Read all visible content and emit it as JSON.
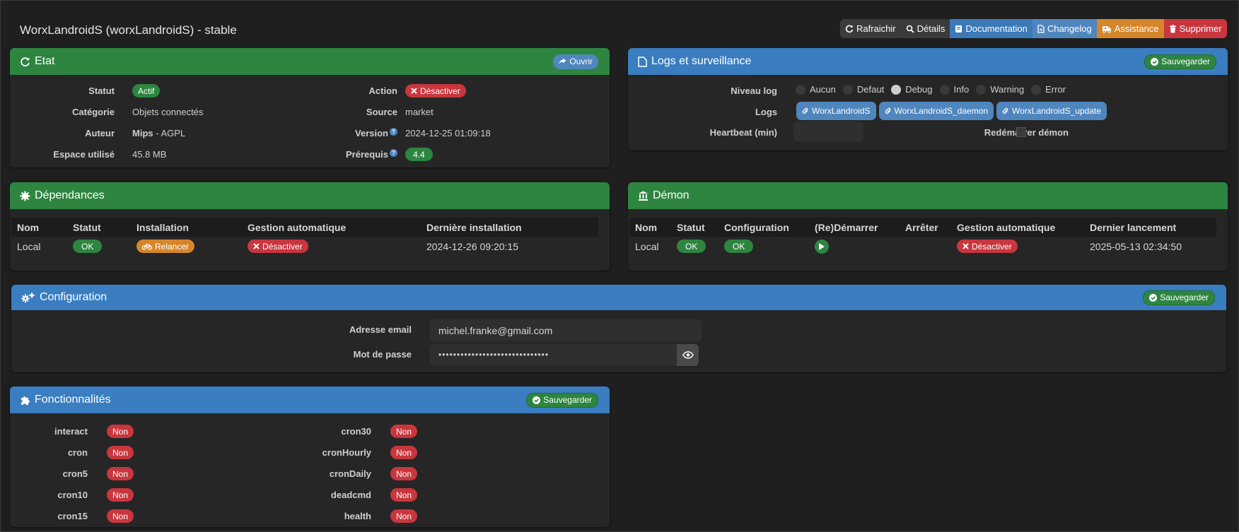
{
  "title": "WorxLandroidS (worxLandroidS) - stable",
  "toolbar": {
    "refresh": "Rafraichir",
    "details": "Détails",
    "documentation": "Documentation",
    "changelog": "Changelog",
    "assistance": "Assistance",
    "delete": "Supprimer"
  },
  "etat": {
    "title": "Etat",
    "open_label": "Ouvrir",
    "statut_label": "Statut",
    "statut_value": "Actif",
    "categorie_label": "Catégorie",
    "categorie_value": "Objets connectés",
    "auteur_label": "Auteur",
    "auteur_value": "Mips",
    "licence_value": "- AGPL",
    "espace_label": "Espace utilisé",
    "espace_value": "45.8 MB",
    "action_label": "Action",
    "action_value": "Désactiver",
    "source_label": "Source",
    "source_value": "market",
    "version_label": "Version",
    "version_value": "2024-12-25 01:09:18",
    "prerequis_label": "Prérequis",
    "prerequis_value": "4.4",
    "help_glyph": "?"
  },
  "logs": {
    "title": "Logs et surveillance",
    "save_label": "Sauvegarder",
    "niveau_label": "Niveau log",
    "levels": [
      "Aucun",
      "Defaut",
      "Debug",
      "Info",
      "Warning",
      "Error"
    ],
    "selected_level": "Debug",
    "logs_label": "Logs",
    "log_files": [
      "WorxLandroidS",
      "WorxLandroidS_daemon",
      "WorxLandroidS_update"
    ],
    "heartbeat_label": "Heartbeat (min)",
    "heartbeat_value": "",
    "restart_label": "Redémarrer démon",
    "restart_checked": false
  },
  "dependances": {
    "title": "Dépendances",
    "headers": [
      "Nom",
      "Statut",
      "Installation",
      "Gestion automatique",
      "Dernière installation"
    ],
    "row": {
      "nom": "Local",
      "statut": "OK",
      "installation": "Relancer",
      "gestion": "Désactiver",
      "derniere": "2024-12-26 09:20:15"
    }
  },
  "demon": {
    "title": "Démon",
    "headers": [
      "Nom",
      "Statut",
      "Configuration",
      "(Re)Démarrer",
      "Arrêter",
      "Gestion automatique",
      "Dernier lancement"
    ],
    "row": {
      "nom": "Local",
      "statut": "OK",
      "configuration": "OK",
      "gestion": "Désactiver",
      "dernier": "2025-05-13 02:34:50"
    }
  },
  "configuration": {
    "title": "Configuration",
    "save_label": "Sauvegarder",
    "email_label": "Adresse email",
    "email_value": "michel.franke@gmail.com",
    "password_label": "Mot de passe",
    "password_value": "••••••••••••••••••••••••••••••"
  },
  "fonctionnalites": {
    "title": "Fonctionnalités",
    "save_label": "Sauvegarder",
    "left": [
      {
        "name": "interact",
        "value": "Non"
      },
      {
        "name": "cron",
        "value": "Non"
      },
      {
        "name": "cron5",
        "value": "Non"
      },
      {
        "name": "cron10",
        "value": "Non"
      },
      {
        "name": "cron15",
        "value": "Non"
      }
    ],
    "right": [
      {
        "name": "cron30",
        "value": "Non"
      },
      {
        "name": "cronHourly",
        "value": "Non"
      },
      {
        "name": "cronDaily",
        "value": "Non"
      },
      {
        "name": "deadcmd",
        "value": "Non"
      },
      {
        "name": "health",
        "value": "Non"
      }
    ]
  },
  "colors": {
    "green": "#2e8540",
    "blue": "#3a7dc0",
    "red": "#c9363e",
    "orange": "#d6862a"
  }
}
